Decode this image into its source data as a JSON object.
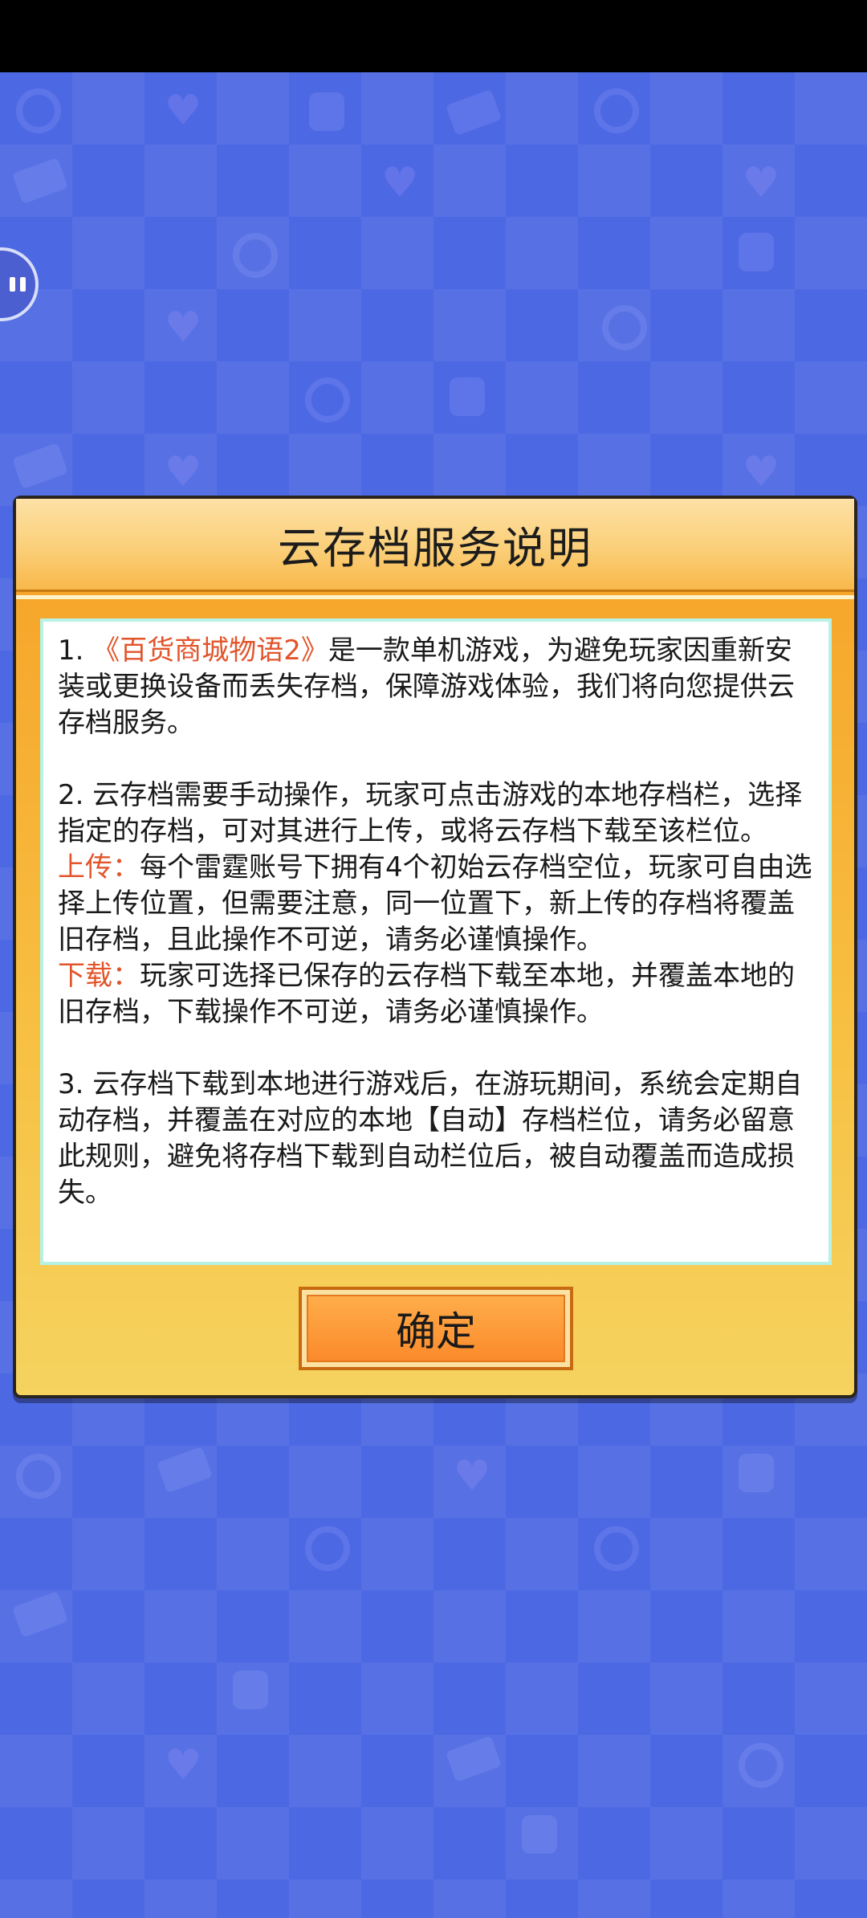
{
  "dialog": {
    "title": "云存档服务说明",
    "confirm_label": "确定"
  },
  "content": {
    "p1_prefix": "1. ",
    "p1_game_name": "《百货商城物语2》",
    "p1_text": "是一款单机游戏，为避免玩家因重新安装或更换设备而丢失存档，保障游戏体验，我们将向您提供云存档服务。",
    "p2_text": "2. 云存档需要手动操作，玩家可点击游戏的本地存档栏，选择指定的存档，可对其进行上传，或将云存档下载至该栏位。",
    "upload_label": "上传：",
    "upload_text": "每个雷霆账号下拥有4个初始云存档空位，玩家可自由选择上传位置，但需要注意，同一位置下，新上传的存档将覆盖旧存档，且此操作不可逆，请务必谨慎操作。",
    "download_label": "下载：",
    "download_text": "玩家可选择已保存的云存档下载至本地，并覆盖本地的旧存档，下载操作不可逆，请务必谨慎操作。",
    "p3_text": "3. 云存档下载到本地进行游戏后，在游玩期间，系统会定期自动存档，并覆盖在对应的本地【自动】存档栏位，请务必留意此规则，避免将存档下载到自动栏位后，被自动覆盖而造成损失。"
  },
  "colors": {
    "background": "#4d68e3",
    "dialog_orange": "#f6a126",
    "highlight": "#e2542a",
    "button_orange": "#fb8a2b"
  },
  "icons": {
    "pause": "pause-icon"
  }
}
